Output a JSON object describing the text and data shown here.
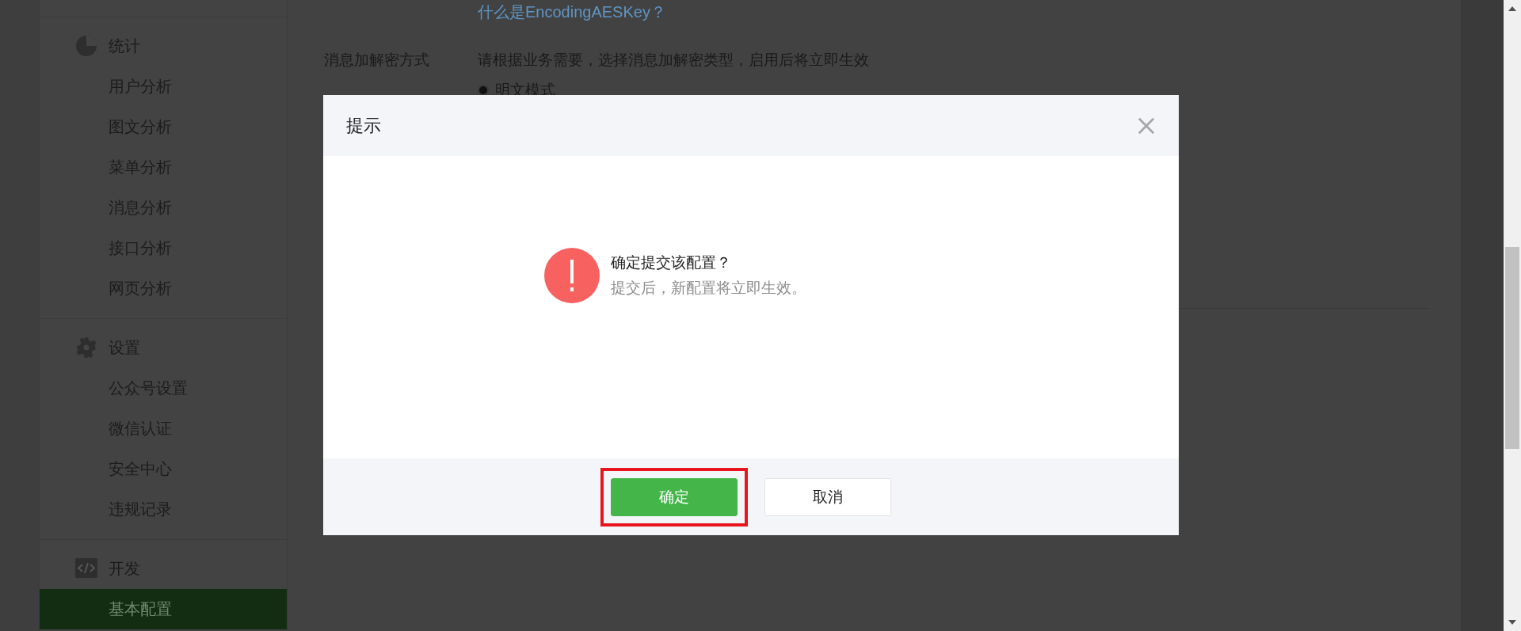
{
  "sidebar": {
    "sections": [
      {
        "title": "统计",
        "kind": "stats",
        "items": [
          {
            "label": "用户分析",
            "selected": false
          },
          {
            "label": "图文分析",
            "selected": false
          },
          {
            "label": "菜单分析",
            "selected": false
          },
          {
            "label": "消息分析",
            "selected": false
          },
          {
            "label": "接口分析",
            "selected": false
          },
          {
            "label": "网页分析",
            "selected": false
          }
        ]
      },
      {
        "title": "设置",
        "kind": "settings",
        "items": [
          {
            "label": "公众号设置",
            "selected": false
          },
          {
            "label": "微信认证",
            "selected": false
          },
          {
            "label": "安全中心",
            "selected": false
          },
          {
            "label": "违规记录",
            "selected": false
          }
        ]
      },
      {
        "title": "开发",
        "kind": "dev",
        "items": [
          {
            "label": "基本配置",
            "selected": true
          }
        ]
      }
    ]
  },
  "content": {
    "help_link": "什么是EncodingAESKey？",
    "field_label": "消息加解密方式",
    "field_hint": "请根据业务需要，选择消息加解密类型，启用后将立即生效",
    "options": [
      {
        "label": "明文模式",
        "selected": true
      }
    ]
  },
  "dialog": {
    "title": "提示",
    "message_title": "确定提交该配置？",
    "message_detail": "提交后，新配置将立即生效。",
    "buttons": [
      {
        "label": "确定",
        "kind": "primary",
        "highlighted": true
      },
      {
        "label": "取消",
        "kind": "default",
        "highlighted": false
      }
    ]
  }
}
